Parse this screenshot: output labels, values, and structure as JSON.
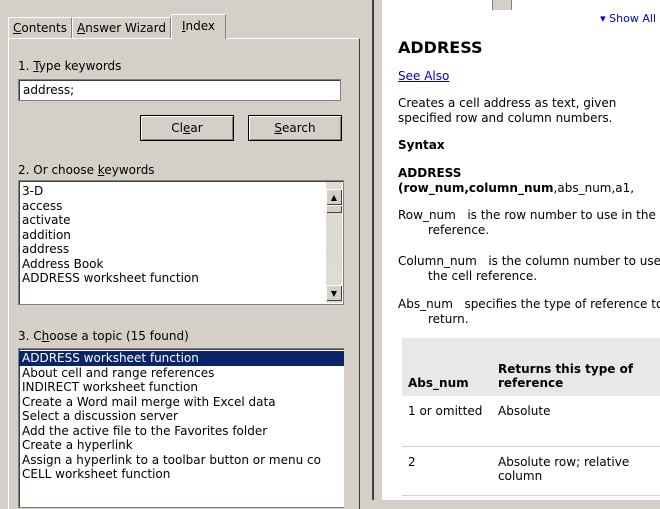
{
  "tabs": [
    {
      "label_pre": "",
      "label_u": "C",
      "label_post": "ontents"
    },
    {
      "label_pre": "",
      "label_u": "A",
      "label_post": "nswer Wizard"
    },
    {
      "label_pre": "",
      "label_u": "I",
      "label_post": "ndex"
    }
  ],
  "step1": {
    "label_pre": "1. ",
    "label_u": "T",
    "label_post": "ype keywords",
    "input_value": "address;"
  },
  "buttons": {
    "clear": {
      "pre": "Cl",
      "u": "e",
      "post": "ar"
    },
    "search": {
      "pre": "",
      "u": "S",
      "post": "earch"
    }
  },
  "step2": {
    "label_pre": "2. Or choose ",
    "label_u": "k",
    "label_post": "eywords",
    "items": [
      "3-D",
      "access",
      "activate",
      "addition",
      "address",
      "Address Book",
      "ADDRESS worksheet function"
    ]
  },
  "step3": {
    "label_pre": "3. C",
    "label_u": "h",
    "label_post": "oose a topic (15 found)",
    "items": [
      "ADDRESS worksheet function",
      "About cell and range references",
      "INDIRECT worksheet function",
      "Create a Word mail merge with Excel data",
      "Select a discussion server",
      "Add the active file to the Favorites folder",
      "Create a hyperlink",
      "Assign a hyperlink to a toolbar button or menu co",
      "CELL worksheet function"
    ],
    "selected_index": 0
  },
  "help": {
    "show_all": "Show All",
    "title": "ADDRESS",
    "see_also": "See Also",
    "description": "Creates a cell address as text, given specified row and column numbers.",
    "syntax_heading": "Syntax",
    "syntax_fn": "ADDRESS",
    "syntax_args_pre": "(",
    "syntax_arg1": "row_num",
    "syntax_comma1": ",",
    "syntax_arg2": "column_num",
    "syntax_rest": ",abs_num,a1,",
    "params": [
      {
        "name": "Row_num",
        "text": "is the row number to use in the cell reference."
      },
      {
        "name": "Column_num",
        "text": "is the column number to use in the cell reference."
      },
      {
        "name": "Abs_num",
        "text": "specifies the type of reference to return."
      }
    ],
    "table": {
      "headers": [
        "Abs_num",
        "Returns this type of reference"
      ],
      "rows": [
        [
          "1 or omitted",
          "Absolute"
        ],
        [
          "2",
          "Absolute row; relative column"
        ]
      ]
    }
  },
  "colors": {
    "selection": "#0a246a",
    "link": "#0000cc",
    "chrome": "#d4d0c8"
  }
}
